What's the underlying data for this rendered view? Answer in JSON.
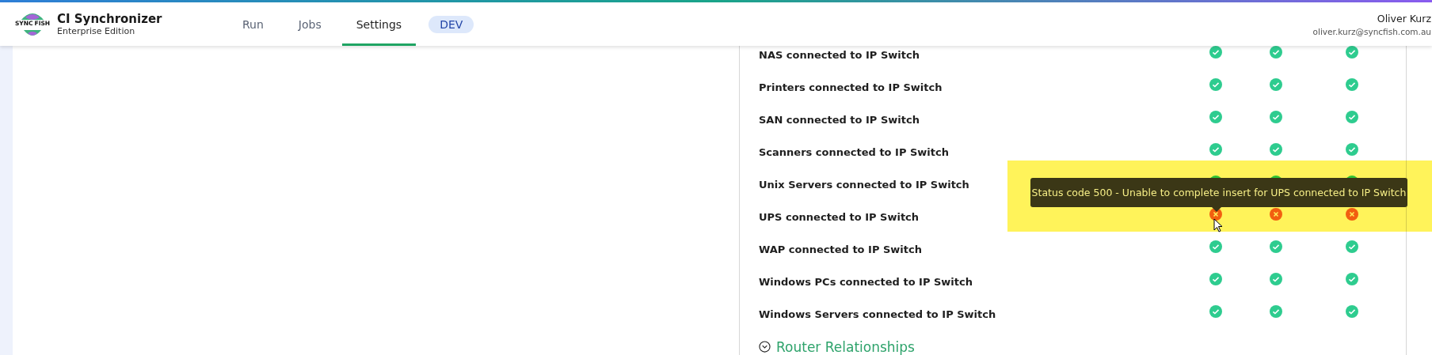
{
  "header": {
    "logo_text": [
      "SYNC",
      "FISH"
    ],
    "title": "CI Synchronizer",
    "subtitle": "Enterprise Edition",
    "tabs": [
      {
        "label": "Run",
        "selected": false
      },
      {
        "label": "Jobs",
        "selected": false
      },
      {
        "label": "Settings",
        "selected": true
      }
    ],
    "environment": "DEV",
    "user": {
      "name": "Oliver Kurz",
      "email": "oliver.kurz@syncfish.com.au"
    }
  },
  "relationships": [
    {
      "label": "NAS connected to IP Switch",
      "statuses": [
        {
          "failed": false
        },
        {
          "failed": false
        },
        {
          "failed": false
        }
      ]
    },
    {
      "label": "Printers connected to IP Switch",
      "statuses": [
        {
          "failed": false
        },
        {
          "failed": false
        },
        {
          "failed": false
        }
      ]
    },
    {
      "label": "SAN connected to IP Switch",
      "statuses": [
        {
          "failed": false
        },
        {
          "failed": false
        },
        {
          "failed": false
        }
      ]
    },
    {
      "label": "Scanners connected to IP Switch",
      "statuses": [
        {
          "failed": false
        },
        {
          "failed": false
        },
        {
          "failed": false
        }
      ]
    },
    {
      "label": "Unix Servers connected to IP Switch",
      "statuses": [
        {
          "failed": false
        },
        {
          "failed": false
        },
        {
          "failed": false
        }
      ]
    },
    {
      "label": "UPS connected to IP Switch",
      "statuses": [
        {
          "failed": true
        },
        {
          "failed": true
        },
        {
          "failed": true
        }
      ]
    },
    {
      "label": "WAP connected to IP Switch",
      "statuses": [
        {
          "failed": false
        },
        {
          "failed": false
        },
        {
          "failed": false
        }
      ]
    },
    {
      "label": "Windows PCs connected to IP Switch",
      "statuses": [
        {
          "failed": false
        },
        {
          "failed": false
        },
        {
          "failed": false
        }
      ]
    },
    {
      "label": "Windows Servers connected to IP Switch",
      "statuses": [
        {
          "failed": false
        },
        {
          "failed": false
        },
        {
          "failed": false
        }
      ]
    }
  ],
  "tooltip": "Status code 500 - Unable to complete insert for UPS connected to IP Switch",
  "section": {
    "title": "Router Relationships",
    "expanded": true
  }
}
